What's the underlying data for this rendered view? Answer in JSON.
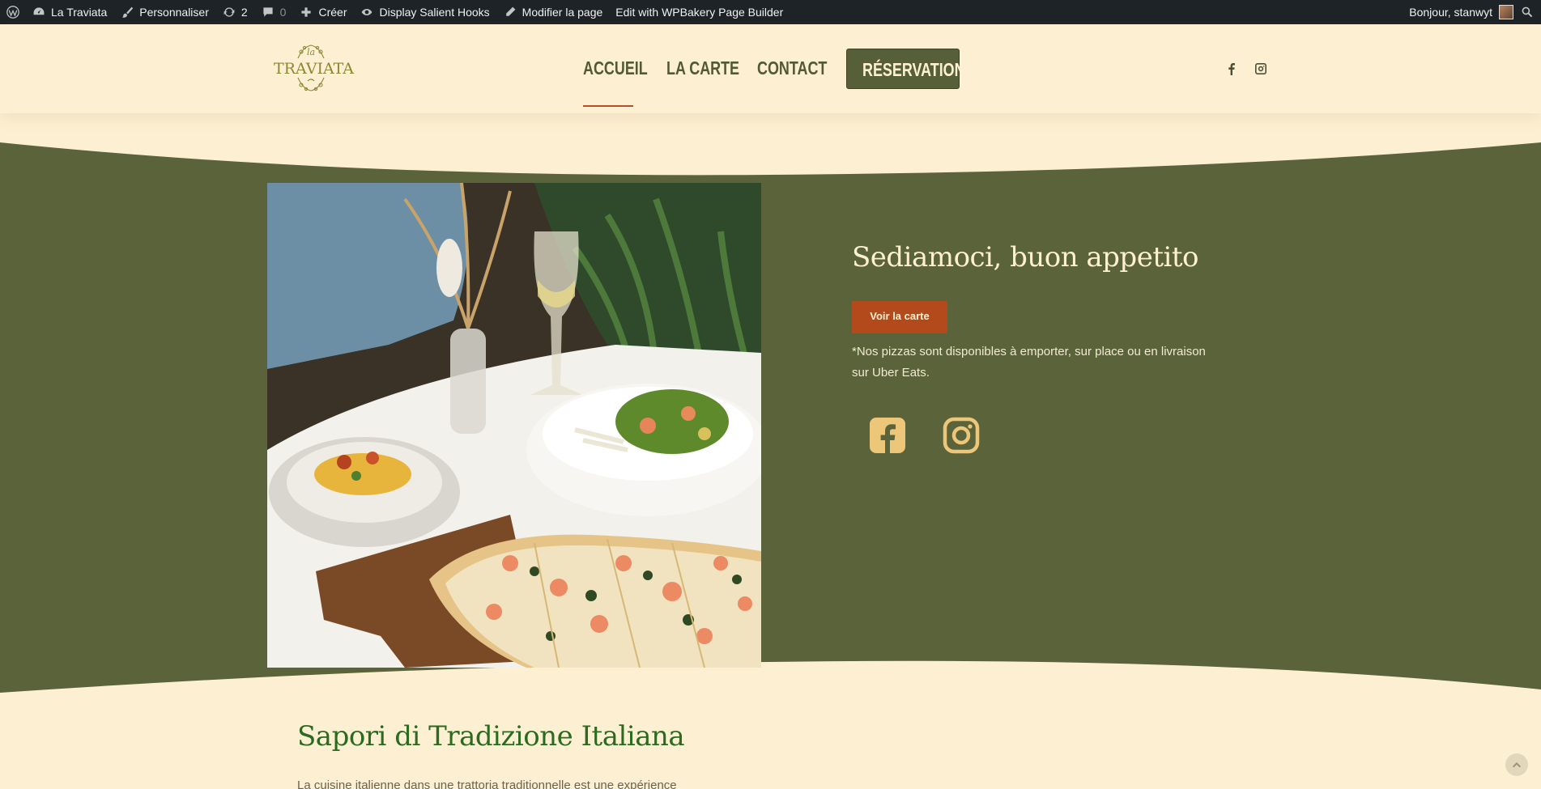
{
  "admin_bar": {
    "wp_logo_icon": "wordpress-icon",
    "site_name": "La Traviata",
    "customize": "Personnaliser",
    "updates_count": "2",
    "comments_count": "0",
    "new": "Créer",
    "salient_hooks": "Display Salient Hooks",
    "edit_page": "Modifier la page",
    "wpbakery": "Edit with WPBakery Page Builder",
    "greeting": "Bonjour, stanwyt"
  },
  "header": {
    "logo_top": "la",
    "logo_text": "TRAVIATA",
    "nav": [
      "ACCUEIL",
      "LA CARTE",
      "CONTACT"
    ],
    "active_nav": "ACCUEIL",
    "reserve_label": "RÉSERVATION",
    "accent_color": "#b4502a",
    "brand_green": "#565f37"
  },
  "hero": {
    "background_color": "#5b633a",
    "title": "Sediamoci, buon appetito",
    "button_label": "Voir la carte",
    "note": "*Nos pizzas sont disponibles à emporter, sur place ou en livraison sur Uber Eats.",
    "social_icons": [
      "facebook-icon",
      "instagram-icon"
    ],
    "icon_color": "#ecc77a"
  },
  "intro": {
    "title": "Sapori di Tradizione Italiana",
    "text": "La cuisine italienne dans une trattoria traditionnelle est une expérience"
  }
}
